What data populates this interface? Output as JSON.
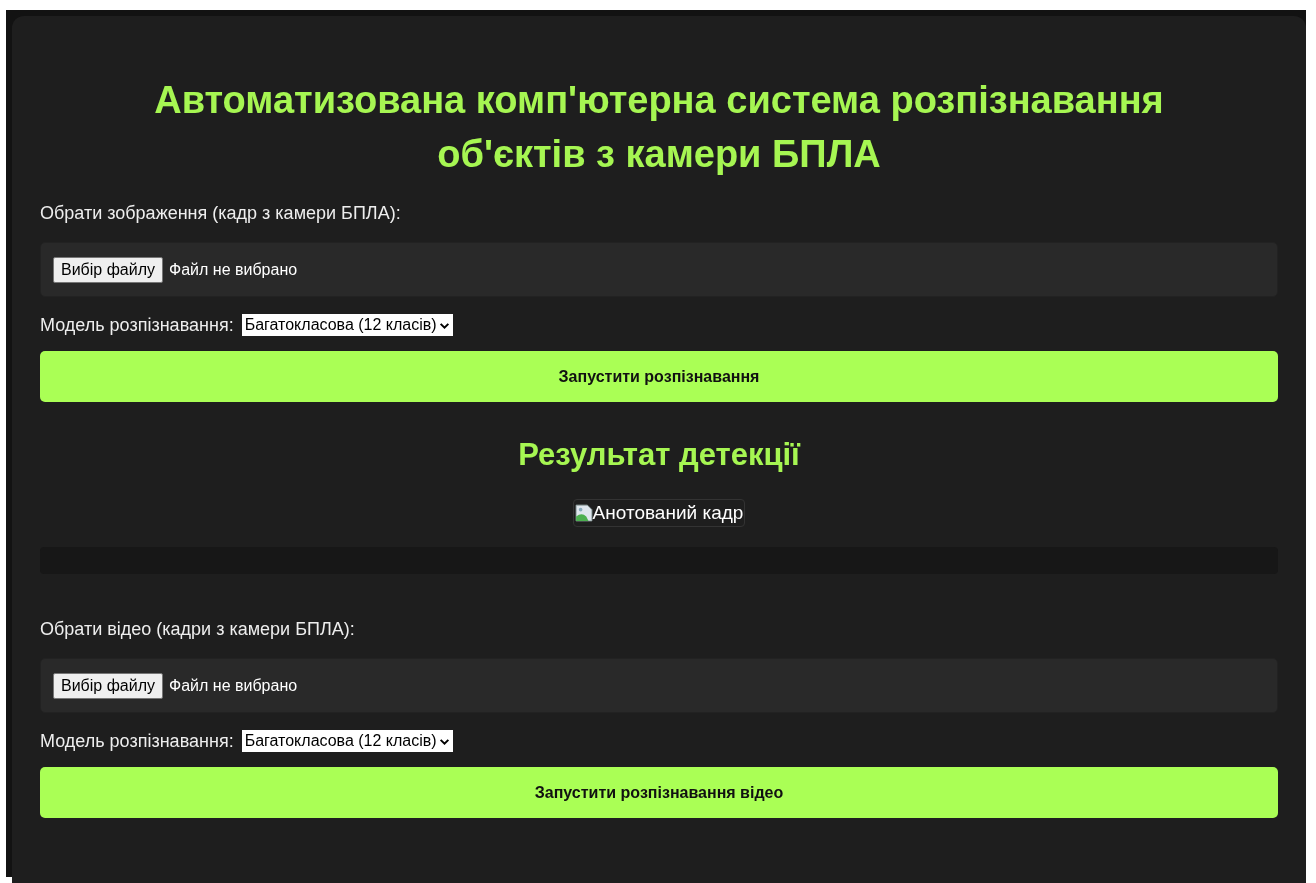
{
  "title": "Автоматизована комп'ютерна система розпізнавання об'єктів з камери БПЛА",
  "image_form": {
    "label": "Обрати зображення (кадр з камери БПЛА):",
    "file_button": "Вибір файлу",
    "file_status": "Файл не вибрано",
    "model_label": "Модель розпізнавання:",
    "model_select": "Багатокласова (12 класів)",
    "submit": "Запустити розпізнавання"
  },
  "result": {
    "heading": "Результат детекції",
    "image_alt": "Анотований кадр"
  },
  "video_form": {
    "label": "Обрати відео (кадри з камери БПЛА):",
    "file_button": "Вибір файлу",
    "file_status": "Файл не вибрано",
    "model_label": "Модель розпізнавання:",
    "model_select": "Багатокласова (12 класів)",
    "submit": "Запустити розпізнавання відео"
  }
}
